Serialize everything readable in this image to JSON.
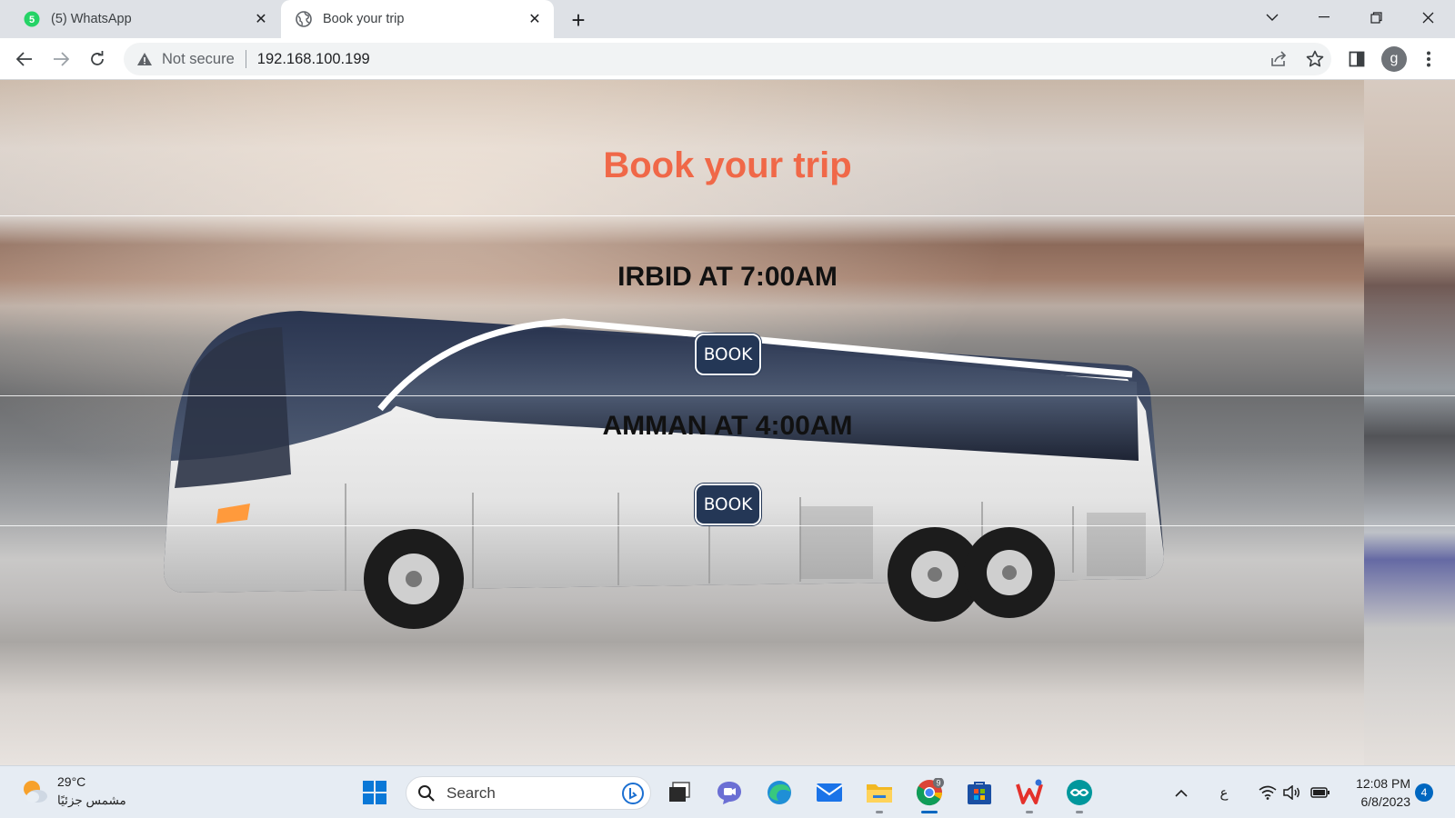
{
  "browser": {
    "tabs": [
      {
        "title": "(5) WhatsApp",
        "favicon": "whatsapp-icon",
        "badge": "5",
        "active": false
      },
      {
        "title": "Book your trip",
        "favicon": "globe-icon",
        "active": true
      }
    ],
    "address_bar": {
      "security_label": "Not secure",
      "url": "192.168.100.199"
    },
    "profile_initial": "g"
  },
  "page": {
    "title": "Book your trip",
    "title_color": "#f06848",
    "trips": [
      {
        "heading": "IRBID AT 7:00AM",
        "button_label": "BOOK"
      },
      {
        "heading": "AMMAN AT 4:00AM",
        "button_label": "BOOK"
      }
    ],
    "button_color": "#243756"
  },
  "taskbar": {
    "weather": {
      "temp": "29°C",
      "description": "مشمس جزئيًا"
    },
    "search_placeholder": "Search",
    "chrome_badge": "9",
    "tray_language": "ع",
    "clock": {
      "time": "12:08 PM",
      "date": "6/8/2023"
    },
    "notification_count": "4"
  }
}
